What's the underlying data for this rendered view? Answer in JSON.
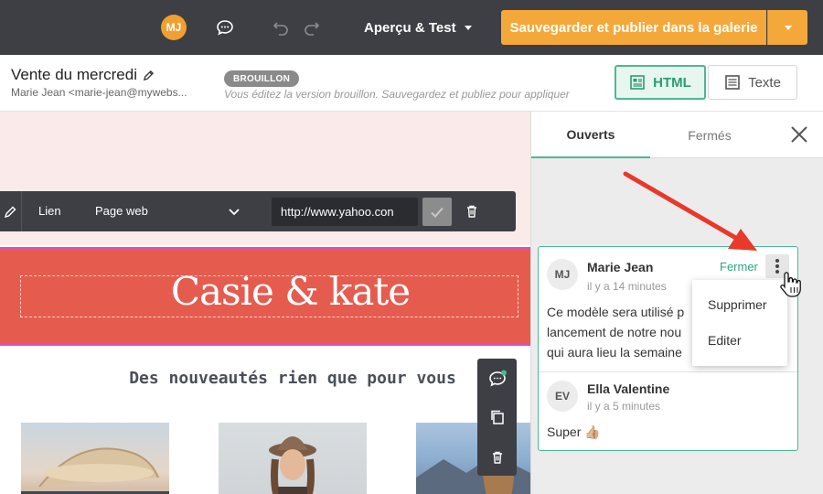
{
  "topbar": {
    "user_initials": "MJ",
    "preview_label": "Aperçu & Test",
    "publish_label": "Sauvegarder et publier dans la galerie"
  },
  "document": {
    "title": "Vente du mercredi",
    "sender": "Marie Jean <marie-jean@mywebs...",
    "status_badge": "BROUILLON",
    "status_note": "Vous éditez la version brouillon. Sauvegardez et publiez pour appliquer",
    "view_html_label": "HTML",
    "view_text_label": "Texte"
  },
  "link_toolbar": {
    "type_label": "Lien",
    "target_label": "Page web",
    "url_value": "http://www.yahoo.con"
  },
  "email": {
    "banner_logo": "Casie & kate",
    "tagline": "Des nouveautés rien que pour vous"
  },
  "comments_panel": {
    "tab_open": "Ouverts",
    "tab_closed": "Fermés",
    "resolve_label": "Fermer",
    "comments": [
      {
        "initials": "MJ",
        "author": "Marie Jean",
        "time": "il y a 14 minutes",
        "text_line1": "Ce modèle sera utilisé p",
        "text_line2": "lancement de notre nou",
        "text_line3": "qui aura lieu la semaine"
      },
      {
        "initials": "EV",
        "author": "Ella Valentine",
        "time": "il y a 5 minutes",
        "text": "Super 👍🏼"
      }
    ],
    "menu": {
      "delete_label": "Supprimer",
      "edit_label": "Editer"
    }
  },
  "colors": {
    "topbar": "#3d3f44",
    "publish": "#f5a83a",
    "accent_green": "#4db892",
    "banner": "#e55c4f",
    "annotation_arrow": "#e8392a"
  }
}
